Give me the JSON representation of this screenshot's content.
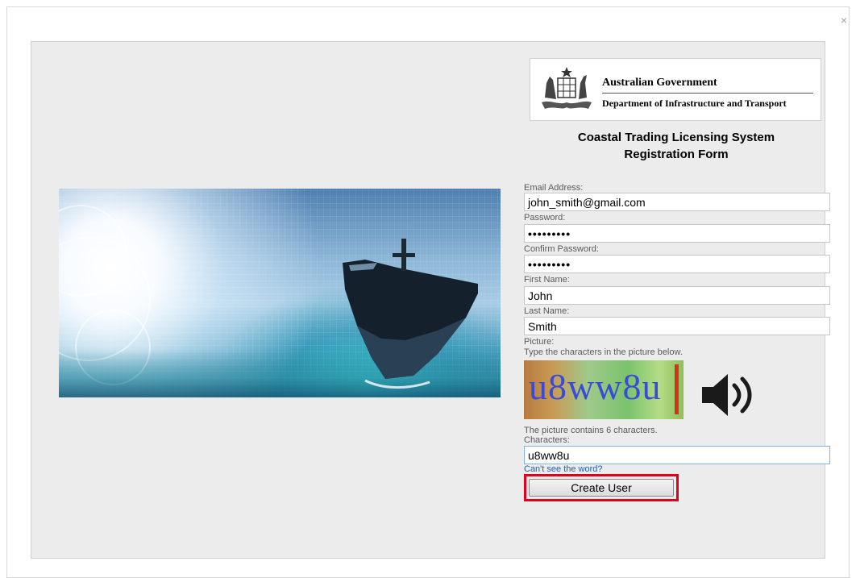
{
  "dialog": {
    "close_label": "×"
  },
  "logo": {
    "government": "Australian Government",
    "department": "Department of Infrastructure and Transport"
  },
  "title": {
    "line1": "Coastal Trading Licensing System",
    "line2": "Registration Form"
  },
  "form": {
    "email": {
      "label": "Email Address:",
      "value": "john_smith@gmail.com"
    },
    "password": {
      "label": "Password:",
      "value": "•••••••••"
    },
    "confirm_password": {
      "label": "Confirm Password:",
      "value": "•••••••••"
    },
    "first_name": {
      "label": "First Name:",
      "value": "John"
    },
    "last_name": {
      "label": "Last Name:",
      "value": "Smith"
    },
    "picture": {
      "label": "Picture:",
      "instructions": "Type the characters in the picture below.",
      "captcha_text": "u8ww8u",
      "note": "The picture contains 6 characters."
    },
    "characters": {
      "label": "Characters:",
      "value": "u8ww8u"
    },
    "cant_see_link": "Can't see the word?",
    "submit_label": "Create User"
  },
  "colors": {
    "highlight": "#e0001a",
    "captcha_text": "#3a4bd6"
  },
  "icons": {
    "speaker": "speaker-volume-icon",
    "crest": "coat-of-arms-icon",
    "close": "close-icon"
  }
}
